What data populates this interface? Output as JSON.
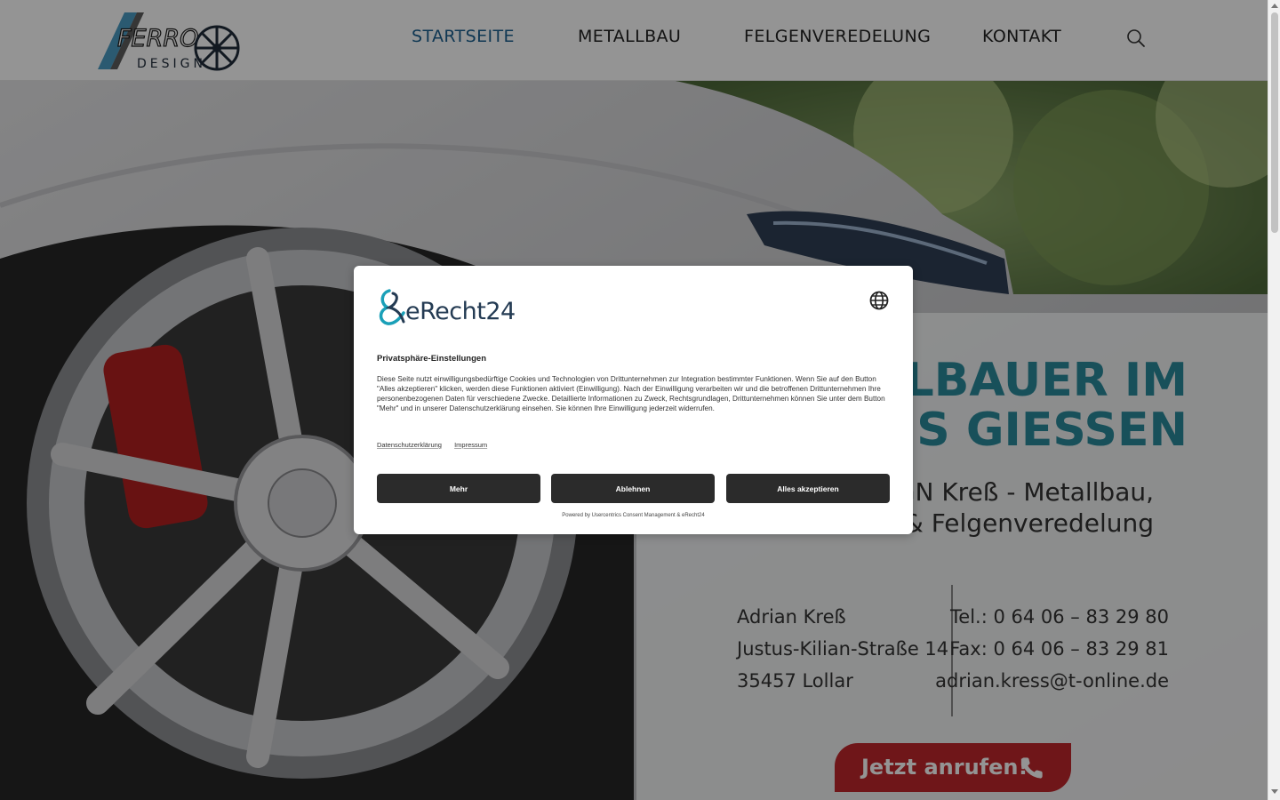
{
  "header": {
    "nav": [
      {
        "label": "STARTSEITE",
        "active": true
      },
      {
        "label": "METALLBAU",
        "active": false
      },
      {
        "label": "FELGENVEREDELUNG",
        "active": false
      },
      {
        "label": "KONTAKT",
        "active": false
      }
    ],
    "logo": {
      "line1": "FERRO",
      "line2": "DESIGN"
    }
  },
  "hero": {
    "title_line1": "METALLBAUER IM",
    "title_line2": "KREIS GIESSEN",
    "subtitle_line1": "FERRO DESIGN Kreß - Metallbau,",
    "subtitle_line2": "Schweißtechnik & Felgenveredelung",
    "contact_left": [
      "Adrian Kreß",
      "Justus-Kilian-Straße 14",
      "35457 Lollar"
    ],
    "contact_right": [
      "Tel.: 0 64 06 – 83 29 80",
      "Fax: 0 64 06 – 83 29 81",
      "adrian.kress@t-online.de"
    ],
    "call_button": "Jetzt anrufen!"
  },
  "consent": {
    "brand": "eRecht24",
    "title": "Privatsphäre-Einstellungen",
    "text": "Diese Seite nutzt einwilligungsbedürftige Cookies und Technologien von Drittunternehmen zur Integration bestimmter Funktionen. Wenn Sie auf den Button \"Alles akzeptieren\" klicken, werden diese Funktionen aktiviert (Einwilligung). Nach der Einwilligung verarbeiten wir und die betroffenen Drittunternehmen Ihre personenbezogenen Daten für verschiedene Zwecke. Detaillierte Informationen zu Zweck, Rechtsgrundlagen, Drittunternehmen können Sie unter dem Button \"Mehr\" und in unserer Datenschutzerklärung einsehen. Sie können Ihre Einwilligung jederzeit widerrufen.",
    "link_privacy": "Datenschutzerklärung",
    "link_imprint": "Impressum",
    "btn_more": "Mehr",
    "btn_decline": "Ablehnen",
    "btn_accept": "Alles akzeptieren",
    "powered": "Powered by Usercentrics Consent Management & eRecht24"
  },
  "colors": {
    "accent": "#2a8a9c",
    "nav_active": "#1b5f8f",
    "call_button": "#c0262b",
    "modal_button": "#2b2b2b"
  },
  "icons": [
    "search-icon",
    "phone-icon",
    "globe-icon",
    "erecht24-logo-icon",
    "ferro-design-logo"
  ]
}
